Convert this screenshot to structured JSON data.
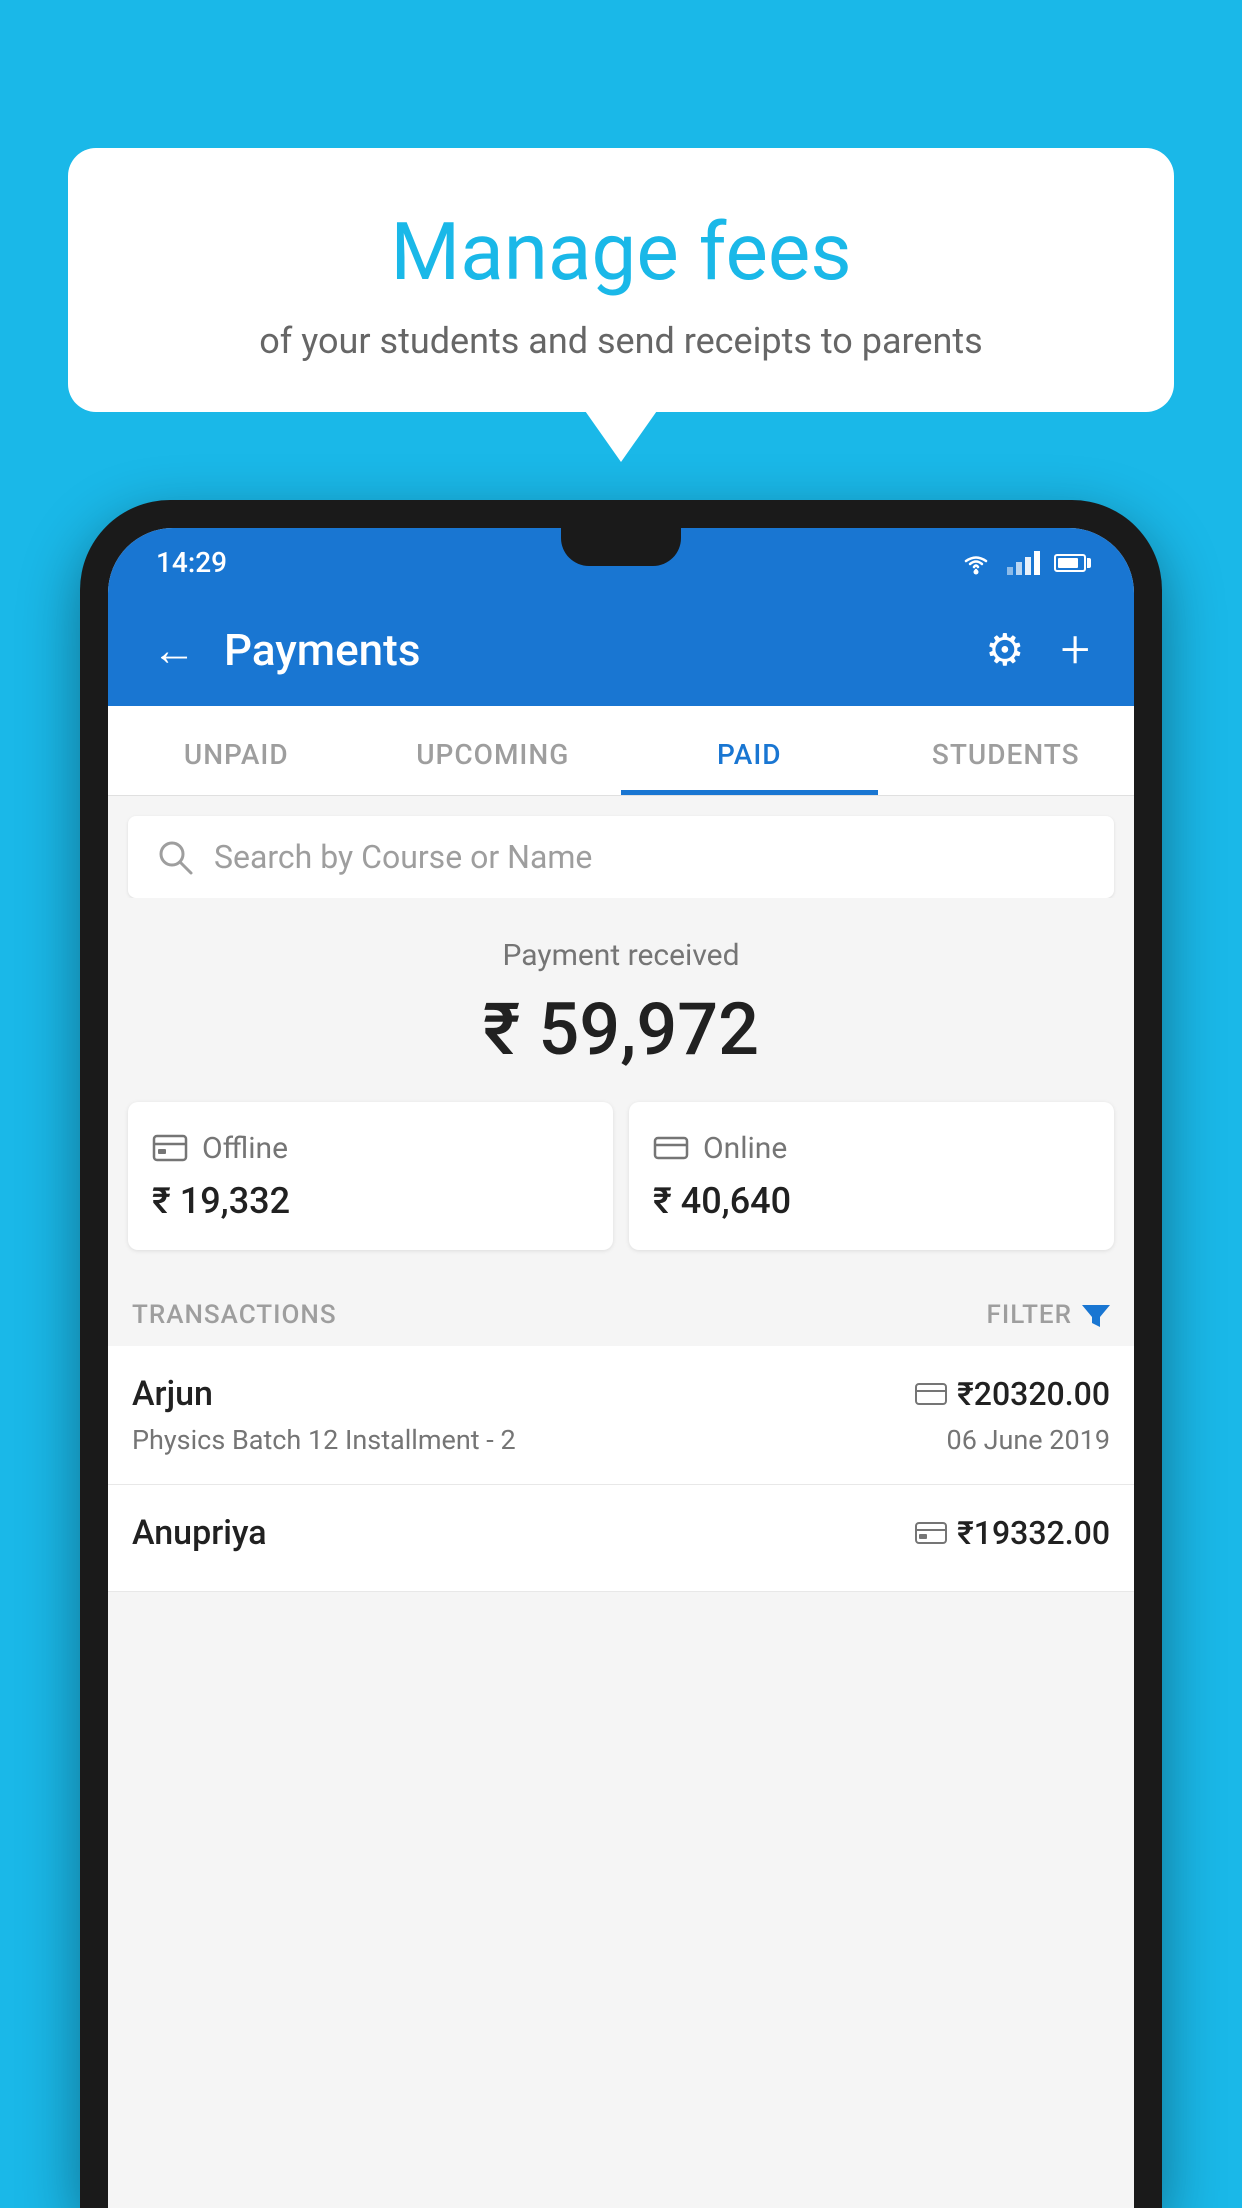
{
  "page": {
    "background_color": "#1ab8e8"
  },
  "speech_bubble": {
    "title": "Manage fees",
    "subtitle": "of your students and send receipts to parents"
  },
  "status_bar": {
    "time": "14:29",
    "background_color": "#1976d2"
  },
  "app_bar": {
    "title": "Payments",
    "back_label": "←",
    "settings_label": "⚙",
    "add_label": "+"
  },
  "tabs": [
    {
      "label": "UNPAID",
      "active": false
    },
    {
      "label": "UPCOMING",
      "active": false
    },
    {
      "label": "PAID",
      "active": true
    },
    {
      "label": "STUDENTS",
      "active": false
    }
  ],
  "search": {
    "placeholder": "Search by Course or Name"
  },
  "payment_summary": {
    "label": "Payment received",
    "total_amount": "₹ 59,972",
    "offline_label": "Offline",
    "offline_amount": "₹ 19,332",
    "online_label": "Online",
    "online_amount": "₹ 40,640"
  },
  "transactions": {
    "header_label": "TRANSACTIONS",
    "filter_label": "FILTER",
    "items": [
      {
        "name": "Arjun",
        "course": "Physics Batch 12 Installment - 2",
        "amount": "₹20320.00",
        "date": "06 June 2019",
        "payment_type": "online"
      },
      {
        "name": "Anupriya",
        "course": "",
        "amount": "₹19332.00",
        "date": "",
        "payment_type": "offline"
      }
    ]
  }
}
